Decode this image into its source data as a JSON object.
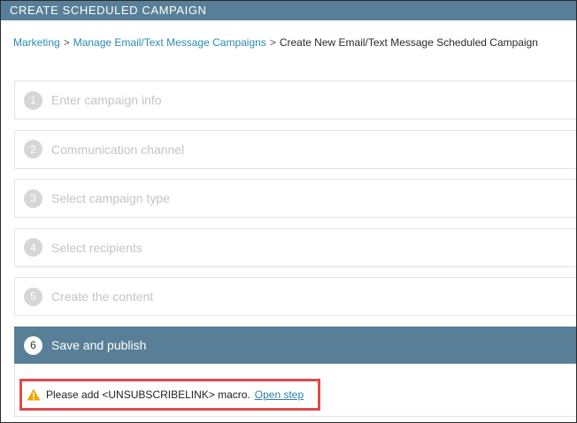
{
  "window": {
    "title": "CREATE SCHEDULED CAMPAIGN"
  },
  "breadcrumb": {
    "items": [
      {
        "label": "Marketing",
        "link": true
      },
      {
        "label": "Manage Email/Text Message Campaigns",
        "link": true
      },
      {
        "label": "Create New Email/Text Message Scheduled Campaign",
        "link": false
      }
    ],
    "separator": ">"
  },
  "steps": [
    {
      "number": "1",
      "label": "Enter campaign info"
    },
    {
      "number": "2",
      "label": "Communication channel"
    },
    {
      "number": "3",
      "label": "Select campaign type"
    },
    {
      "number": "4",
      "label": "Select recipients"
    },
    {
      "number": "5",
      "label": "Create the content"
    },
    {
      "number": "6",
      "label": "Save and publish"
    }
  ],
  "warning": {
    "icon": "warning-triangle-icon",
    "text": "Please add <UNSUBSCRIBELINK> macro.",
    "link_label": "Open step",
    "icon_color": "#f0a500",
    "highlight_color": "#e04a4a"
  },
  "colors": {
    "header": "#587f97",
    "link": "#2a8bb3"
  }
}
